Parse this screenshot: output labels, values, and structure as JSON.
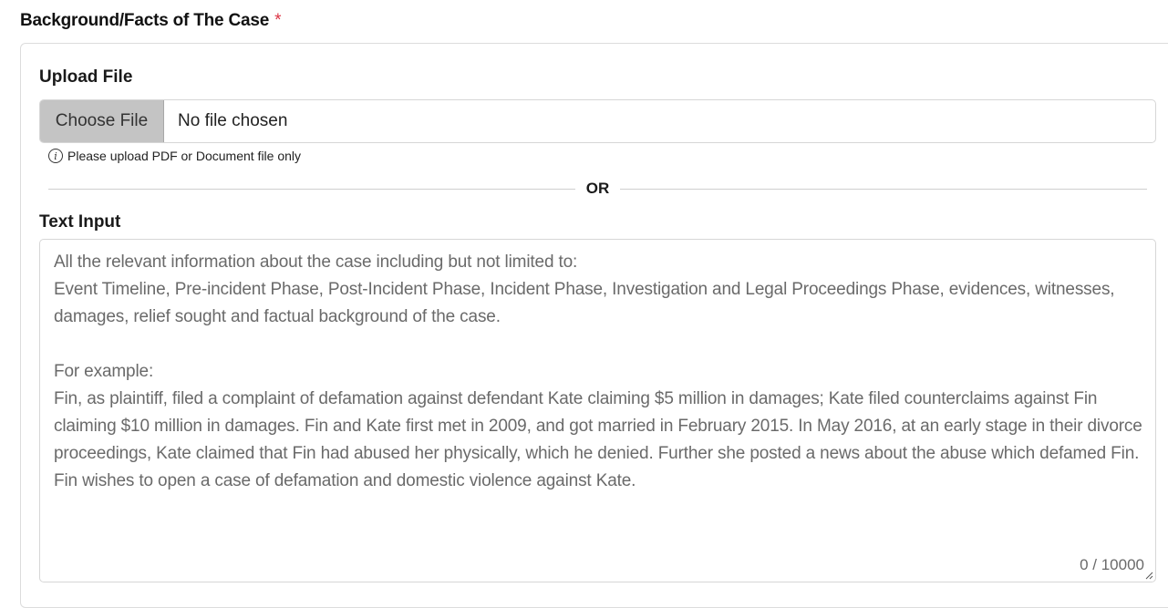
{
  "section": {
    "title": "Background/Facts of The Case",
    "required_mark": "*"
  },
  "upload": {
    "label": "Upload File",
    "button_label": "Choose File",
    "status": "No file chosen",
    "hint": "Please upload PDF or Document file only"
  },
  "divider": {
    "text": "OR"
  },
  "text_input": {
    "label": "Text Input",
    "placeholder": "All the relevant information about the case including but not limited to:\nEvent Timeline, Pre-incident Phase, Post-Incident Phase, Incident Phase, Investigation and Legal Proceedings Phase, evidences, witnesses, damages, relief sought and factual background of the case.\n\nFor example:\nFin, as plaintiff, filed a complaint of defamation against defendant Kate claiming $5 million in damages; Kate filed counterclaims against Fin claiming $10 million in damages. Fin and Kate first met in 2009, and got married in February 2015. In May 2016, at an early stage in their divorce proceedings, Kate claimed that Fin had abused her physically, which he denied. Further she posted a news about the abuse which defamed Fin. Fin wishes to open a case of defamation and domestic violence against Kate.",
    "value": "",
    "counter": "0 / 10000"
  },
  "colors": {
    "required": "#dc3545",
    "button_bg": "#c4c4c4",
    "placeholder": "#6a6a6a"
  },
  "icons": {
    "hint": "info-icon",
    "resize": "resize-handle-icon"
  }
}
